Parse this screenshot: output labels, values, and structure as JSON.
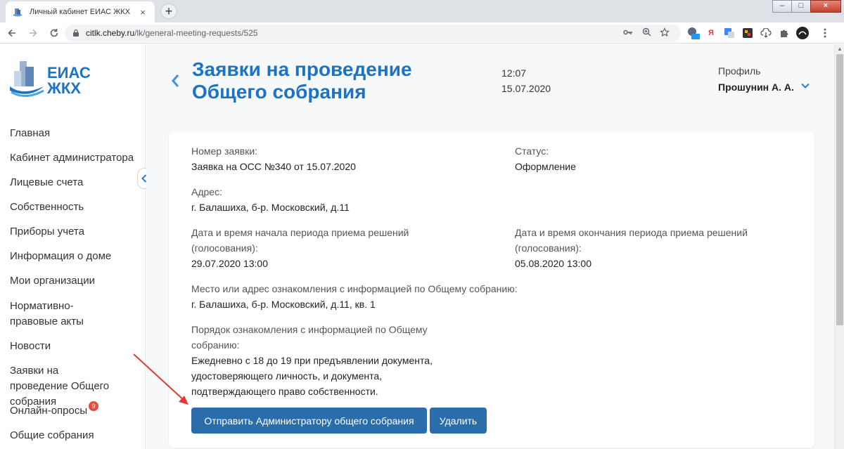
{
  "browser": {
    "tab_title": "Личный кабинет ЕИАС ЖКХ",
    "tab_close": "×",
    "new_tab": "+",
    "url_host": "citlk.cheby.ru",
    "url_path": "/lk/general-meeting-requests/525",
    "win_min": "–",
    "win_max": "□",
    "win_close": "×",
    "ext_ya": "Я"
  },
  "sidebar": {
    "logo_line1": "ЕИАС",
    "logo_line2": "ЖКХ",
    "items": [
      {
        "label": "Главная"
      },
      {
        "label": "Кабинет администратора"
      },
      {
        "label": "Лицевые счета"
      },
      {
        "label": "Собственность"
      },
      {
        "label": "Приборы учета"
      },
      {
        "label": "Информация о доме"
      },
      {
        "label": "Мои организации"
      },
      {
        "label": "Нормативно-правовые акты"
      },
      {
        "label": "Новости"
      },
      {
        "label": "Заявки на проведение Общего собрания"
      },
      {
        "label": "Онлайн-опросы",
        "badge": "9"
      },
      {
        "label": "Общие собрания"
      }
    ]
  },
  "header": {
    "title": "Заявки на проведение Общего собрания",
    "time": "12:07",
    "date": "15.07.2020",
    "profile_label": "Профиль",
    "profile_name": "Прошунин А. А."
  },
  "request": {
    "number_label": "Номер заявки:",
    "number_value": "Заявка на ОСС №340 от 15.07.2020",
    "status_label": "Статус:",
    "status_value": "Оформление",
    "address_label": "Адрес:",
    "address_value": "г. Балашиха, б-р. Московский, д.11",
    "start_label": "Дата и время начала периода приема решений (голосования):",
    "start_value": "29.07.2020 13:00",
    "end_label": "Дата и время окончания периода приема решений (голосования):",
    "end_value": "05.08.2020 13:00",
    "place_label": "Место или адрес ознакомления с информацией по Общему собранию:",
    "place_value": "г. Балашиха, б-р. Московский, д.11, кв. 1",
    "order_label": "Порядок ознакомления с информацией по Общему собранию:",
    "order_value": "Ежедневно с 18 до 19 при предъявлении документа, удостоверяющего личность, и документа, подтверждающего право собственности."
  },
  "actions": {
    "send_label": "Отправить Администратору общего собрания",
    "delete_label": "Удалить"
  },
  "colors": {
    "brand_blue": "#1b73c6",
    "button_blue": "#2b6cab",
    "badge_red": "#e74c3c",
    "annotation_arrow": "#e53935"
  }
}
